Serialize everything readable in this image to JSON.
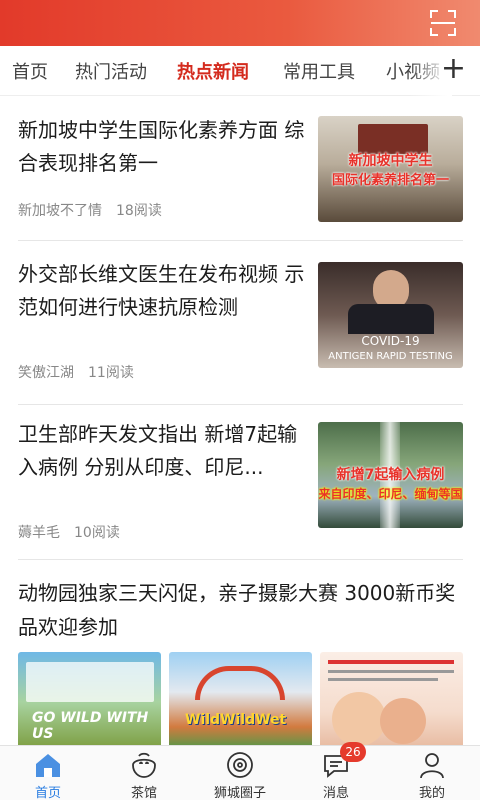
{
  "tabs": [
    "首页",
    "热门活动",
    "热点新闻",
    "常用工具",
    "小视频"
  ],
  "active_tab": "热点新闻",
  "colors": {
    "brand_red": "#d42b1e",
    "nav_active": "#2a7de1",
    "badge": "#e53a2c"
  },
  "icons": {
    "scan": "scan-icon",
    "add": "plus-icon"
  },
  "feed": [
    {
      "title": "新加坡中学生国际化素养方面 综合表现排名第一",
      "author": "新加坡不了情",
      "reads": "18阅读",
      "thumb_caption_line1": "新加坡中学生",
      "thumb_caption_line2": "国际化素养排名第一"
    },
    {
      "title": "外交部长维文医生在发布视频 示范如何进行快速抗原检测",
      "author": "笑傲江湖",
      "reads": "11阅读",
      "thumb_caption_line1": "COVID-19",
      "thumb_caption_line2": "ANTIGEN RAPID TESTING"
    },
    {
      "title": "卫生部昨天发文指出 新增7起输入病例 分别从印度、印尼...",
      "author": "薅羊毛",
      "reads": "10阅读",
      "thumb_caption_line1": "新增7起输入病例",
      "thumb_caption_line2": "来自印度、印尼、缅甸等国"
    },
    {
      "title": "动物园独家三天闪促，亲子摄影大赛 3000新币奖品欢迎参加",
      "gallery_labels": [
        "GO WILD WITH US",
        "WildWildWet",
        ""
      ]
    }
  ],
  "bottom_nav": [
    {
      "label": "首页",
      "icon": "home-icon",
      "active": true
    },
    {
      "label": "茶馆",
      "icon": "teahouse-icon"
    },
    {
      "label": "狮城圈子",
      "icon": "circle-icon"
    },
    {
      "label": "消息",
      "icon": "message-icon",
      "badge": "26"
    },
    {
      "label": "我的",
      "icon": "profile-icon"
    }
  ]
}
